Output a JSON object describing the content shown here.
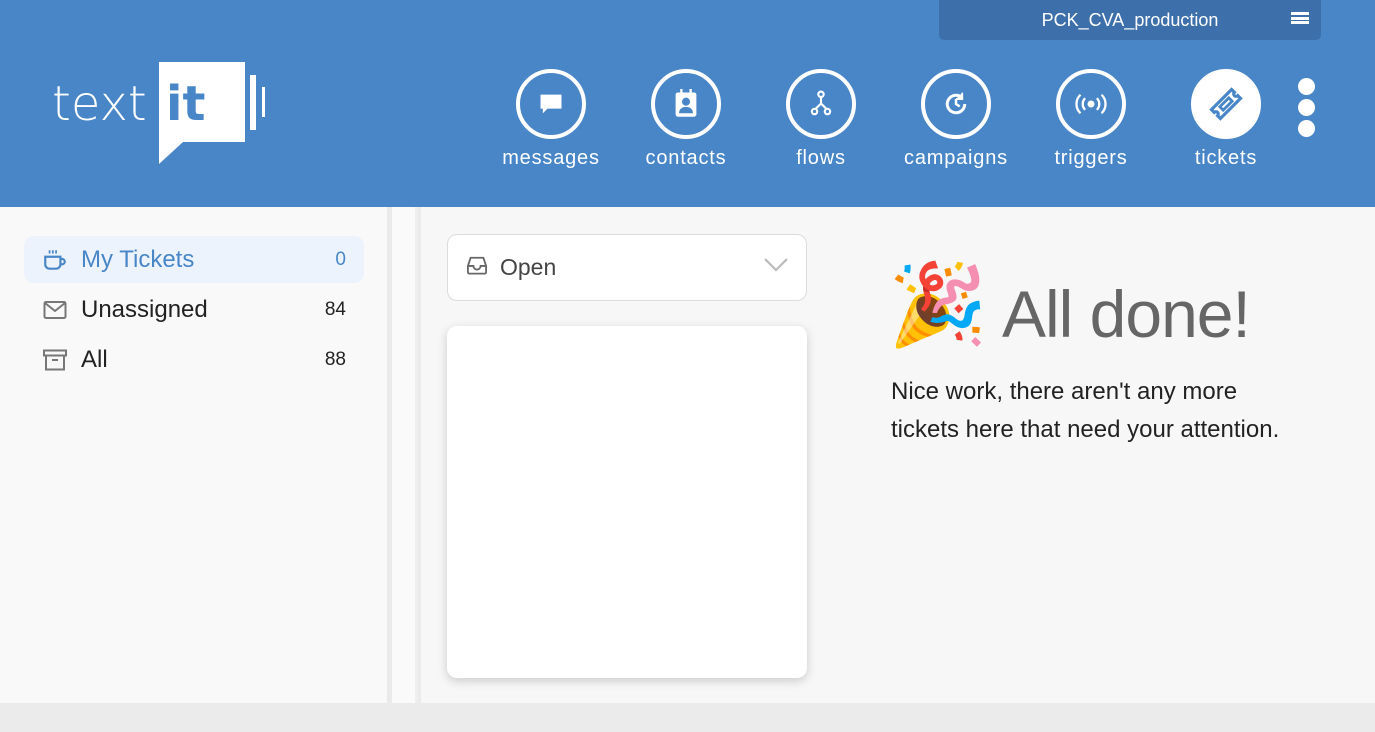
{
  "brand": {
    "name_light": "text",
    "name_box": "it",
    "color": "#4886c8"
  },
  "org": {
    "name": "PCK_CVA_production",
    "menu_icon": "hamburger-icon"
  },
  "nav": {
    "items": [
      {
        "label": "messages",
        "icon": "chat-bubble-icon",
        "active": false
      },
      {
        "label": "contacts",
        "icon": "contact-card-icon",
        "active": false
      },
      {
        "label": "flows",
        "icon": "flow-branch-icon",
        "active": false
      },
      {
        "label": "campaigns",
        "icon": "clock-refresh-icon",
        "active": false
      },
      {
        "label": "triggers",
        "icon": "broadcast-icon",
        "active": true
      },
      {
        "label": "tickets",
        "icon": "ticket-icon",
        "active": true
      }
    ],
    "more_icon": "vertical-dots-icon"
  },
  "sidebar": {
    "items": [
      {
        "label": "My Tickets",
        "count": "0",
        "icon": "mug-icon",
        "active": true
      },
      {
        "label": "Unassigned",
        "count": "84",
        "icon": "envelope-icon",
        "active": false
      },
      {
        "label": "All",
        "count": "88",
        "icon": "archive-box-icon",
        "active": false
      }
    ]
  },
  "filter": {
    "selected": "Open",
    "icon": "inbox-icon"
  },
  "empty_state": {
    "emoji": "🎉",
    "title": "All done!",
    "message": "Nice work, there aren't any more tickets here that need your attention."
  }
}
